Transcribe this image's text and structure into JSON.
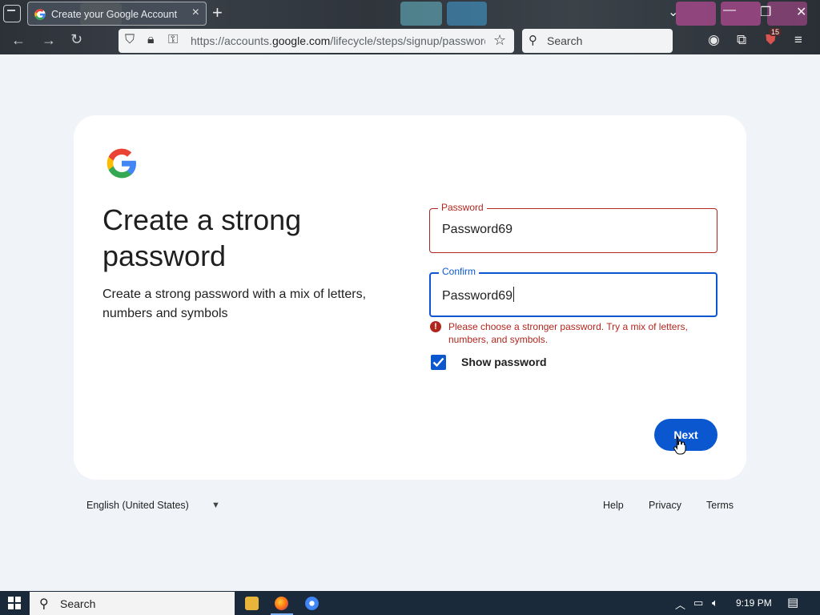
{
  "browser": {
    "tab_title": "Create your Google Account",
    "url_prefix": "https://accounts.",
    "url_domain": "google.com",
    "url_path": "/lifecycle/steps/signup/password",
    "search_placeholder": "Search",
    "notification_count": "15"
  },
  "page": {
    "heading": "Create a strong password",
    "subtext": "Create a strong password with a mix of letters, numbers and symbols",
    "password_label": "Password",
    "password_value": "Password69",
    "confirm_label": "Confirm",
    "confirm_value": "Password69",
    "error_message": "Please choose a stronger password. Try a mix of letters, numbers, and symbols.",
    "show_password_label": "Show password",
    "show_password_checked": true,
    "next_label": "Next"
  },
  "footer": {
    "language": "English (United States)",
    "links": [
      "Help",
      "Privacy",
      "Terms"
    ]
  },
  "taskbar": {
    "search_label": "Search",
    "time": "9:19 PM"
  },
  "colors": {
    "accent": "#0b57d0",
    "error": "#b3261e",
    "page_bg": "#f0f4f9"
  }
}
